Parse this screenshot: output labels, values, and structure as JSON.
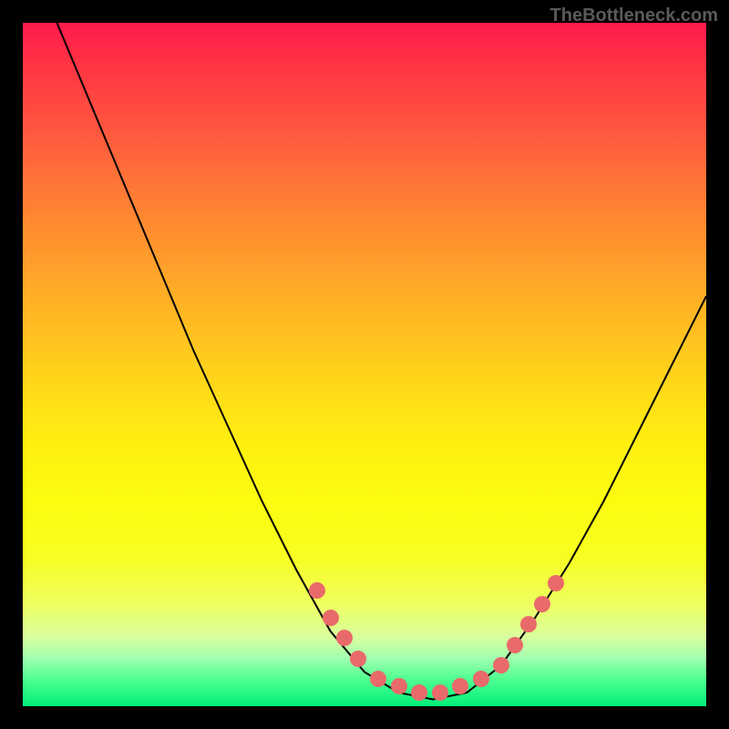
{
  "watermark": "TheBottleneck.com",
  "chart_data": {
    "type": "line",
    "title": "",
    "xlabel": "",
    "ylabel": "",
    "xlim": [
      0,
      100
    ],
    "ylim": [
      0,
      100
    ],
    "curve": [
      {
        "x": 5,
        "y": 100
      },
      {
        "x": 10,
        "y": 88
      },
      {
        "x": 15,
        "y": 76
      },
      {
        "x": 20,
        "y": 64
      },
      {
        "x": 25,
        "y": 52
      },
      {
        "x": 30,
        "y": 41
      },
      {
        "x": 35,
        "y": 30
      },
      {
        "x": 40,
        "y": 20
      },
      {
        "x": 45,
        "y": 11
      },
      {
        "x": 50,
        "y": 5
      },
      {
        "x": 55,
        "y": 2
      },
      {
        "x": 60,
        "y": 1
      },
      {
        "x": 65,
        "y": 2
      },
      {
        "x": 70,
        "y": 6
      },
      {
        "x": 75,
        "y": 13
      },
      {
        "x": 80,
        "y": 21
      },
      {
        "x": 85,
        "y": 30
      },
      {
        "x": 90,
        "y": 40
      },
      {
        "x": 95,
        "y": 50
      },
      {
        "x": 100,
        "y": 60
      }
    ],
    "markers": [
      {
        "x": 43,
        "y": 17
      },
      {
        "x": 45,
        "y": 13
      },
      {
        "x": 47,
        "y": 10
      },
      {
        "x": 49,
        "y": 7
      },
      {
        "x": 52,
        "y": 4
      },
      {
        "x": 55,
        "y": 3
      },
      {
        "x": 58,
        "y": 2
      },
      {
        "x": 61,
        "y": 2
      },
      {
        "x": 64,
        "y": 3
      },
      {
        "x": 67,
        "y": 4
      },
      {
        "x": 70,
        "y": 6
      },
      {
        "x": 72,
        "y": 9
      },
      {
        "x": 74,
        "y": 12
      },
      {
        "x": 76,
        "y": 15
      },
      {
        "x": 78,
        "y": 18
      }
    ]
  }
}
